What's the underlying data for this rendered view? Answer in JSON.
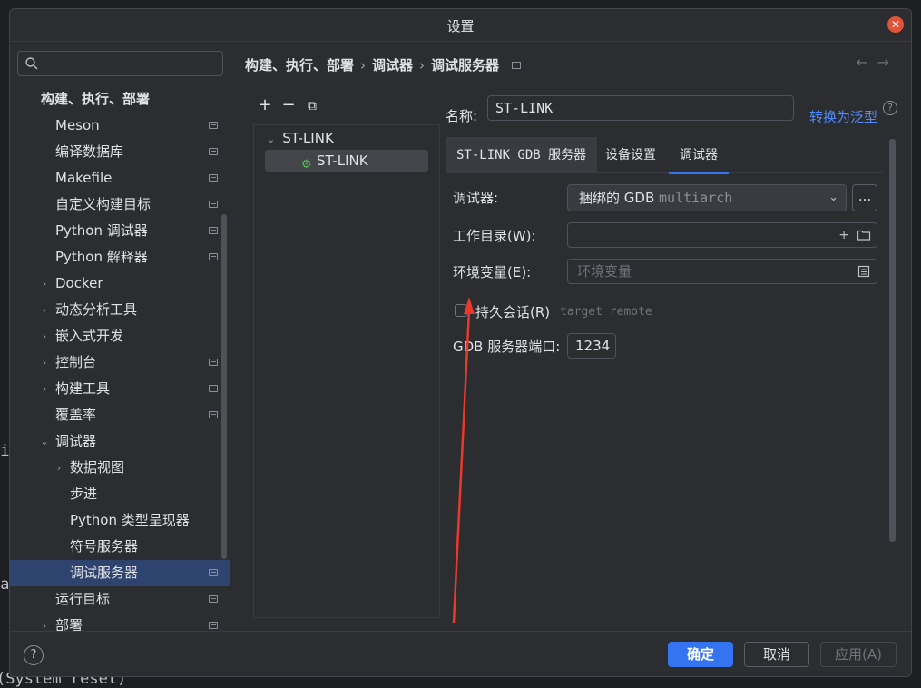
{
  "background": {
    "fragment_left_top": "ai",
    "fragment_left_mid": "la",
    "fragment_bottom": "(System reset)"
  },
  "dialog": {
    "title": "设置",
    "close_icon": "close-icon"
  },
  "sidebar": {
    "search_placeholder": "",
    "items": [
      {
        "label": "构建、执行、部署",
        "level": 0,
        "expander": "",
        "pinned": false,
        "bold": true
      },
      {
        "label": "Meson",
        "level": 1,
        "expander": "",
        "pinned": true
      },
      {
        "label": "编译数据库",
        "level": 1,
        "expander": "",
        "pinned": true
      },
      {
        "label": "Makefile",
        "level": 1,
        "expander": "",
        "pinned": true
      },
      {
        "label": "自定义构建目标",
        "level": 1,
        "expander": "",
        "pinned": true
      },
      {
        "label": "Python 调试器",
        "level": 1,
        "expander": "",
        "pinned": true
      },
      {
        "label": "Python 解释器",
        "level": 1,
        "expander": "",
        "pinned": true
      },
      {
        "label": "Docker",
        "level": 1,
        "expander": "›",
        "pinned": false
      },
      {
        "label": "动态分析工具",
        "level": 1,
        "expander": "›",
        "pinned": false
      },
      {
        "label": "嵌入式开发",
        "level": 1,
        "expander": "›",
        "pinned": false
      },
      {
        "label": "控制台",
        "level": 1,
        "expander": "›",
        "pinned": true
      },
      {
        "label": "构建工具",
        "level": 1,
        "expander": "›",
        "pinned": true
      },
      {
        "label": "覆盖率",
        "level": 1,
        "expander": "",
        "pinned": true
      },
      {
        "label": "调试器",
        "level": 1,
        "expander": "⌄",
        "pinned": false
      },
      {
        "label": "数据视图",
        "level": 2,
        "expander": "›",
        "pinned": false
      },
      {
        "label": "步进",
        "level": 2,
        "expander": "",
        "pinned": false
      },
      {
        "label": "Python 类型呈现器",
        "level": 2,
        "expander": "",
        "pinned": false
      },
      {
        "label": "符号服务器",
        "level": 2,
        "expander": "",
        "pinned": false
      },
      {
        "label": "调试服务器",
        "level": 2,
        "expander": "",
        "pinned": true,
        "selected": true
      },
      {
        "label": "运行目标",
        "level": 1,
        "expander": "",
        "pinned": true
      },
      {
        "label": "部署",
        "level": 1,
        "expander": "›",
        "pinned": true
      }
    ]
  },
  "breadcrumb": {
    "part1": "构建、执行、部署",
    "part2": "调试器",
    "part3": "调试服务器",
    "sep": "›"
  },
  "toolbar": {
    "add": "+",
    "remove": "−",
    "copy": "⧉"
  },
  "tree": {
    "root_label": "ST-LINK",
    "child_label": "ST-LINK"
  },
  "name": {
    "label": "名称:",
    "value": "ST-LINK",
    "convert_link": "转换为泛型",
    "help": "?"
  },
  "tabs": {
    "items": [
      "ST-LINK GDB 服务器",
      "设备设置",
      "调试器"
    ],
    "active_index": 2
  },
  "form": {
    "debugger_label": "调试器:",
    "debugger_value": "捆绑的 GDB",
    "debugger_value_dim": "multiarch",
    "more_button": "...",
    "workdir_label": "工作目录(W):",
    "workdir_value": "",
    "env_label": "环境变量(E):",
    "env_placeholder": "环境变量",
    "persistent_label": "持久会话(R)",
    "persistent_checked": false,
    "persistent_hint": "target remote",
    "port_label": "GDB 服务器端口:",
    "port_value": "1234"
  },
  "footer": {
    "help": "?",
    "ok": "确定",
    "cancel": "取消",
    "apply": "应用(A)"
  },
  "colors": {
    "accent": "#3574f0",
    "link": "#548af7",
    "selection": "#2e436e",
    "annotation_arrow": "#e8392c",
    "close": "#e0553a"
  }
}
